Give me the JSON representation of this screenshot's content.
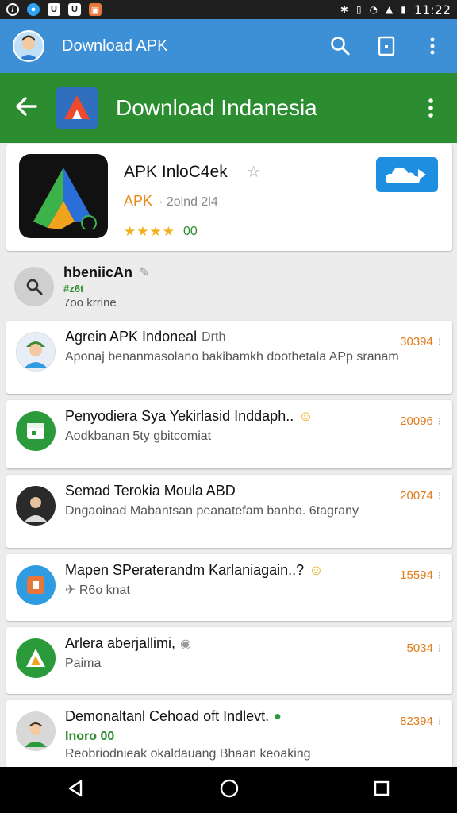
{
  "status_bar": {
    "time": "11:22"
  },
  "top_bar": {
    "title": "Download APK"
  },
  "header": {
    "title": "Download Indanesia"
  },
  "app": {
    "name": "APK InloC4ek",
    "brand": "APK",
    "date": "2oind 2l4",
    "rating_count": "00"
  },
  "search": {
    "title": "hbeniicAn",
    "tag": "#z6t",
    "subtitle": "7oo krrine"
  },
  "items": [
    {
      "title": "Agrein APK Indoneal",
      "title_extra": "Drth",
      "sub": "Aponaj benanmasolano bakibamkh doothetala APp sranam",
      "count": "30394",
      "avatar_color": "#e7eef7",
      "icon": "person"
    },
    {
      "title": "Penyodiera Sya Yekirlasid Inddaph..",
      "title_extra": "",
      "sub": "Aodkbanan 5ty gbitcomiat",
      "count": "20096",
      "avatar_color": "#2b9a3a",
      "icon": "calendar"
    },
    {
      "title": "Semad Terokia Moula ABD",
      "title_extra": "",
      "sub": "Dngaoinad Mabantsan peanatefam banbo. 6tagrany",
      "count": "20074",
      "avatar_color": "#2a2a2a",
      "icon": "person-dark"
    },
    {
      "title": "Mapen SPeraterandm Karlaniagain..?",
      "title_extra": "",
      "sub": "R6o knat",
      "count": "15594",
      "avatar_color": "#2f9be0",
      "icon": "app"
    },
    {
      "title": "Arlera aberjallimi,",
      "title_extra": "",
      "sub": "Paima",
      "count": "5034",
      "avatar_color": "#2b9a3a",
      "icon": "logo"
    },
    {
      "title": "Demonaltanl Cehoad oft Indlevt.",
      "title_extra": "",
      "sub_green": "Inoro 00",
      "sub": "Reobriodnieak okaldauang Bhaan keoaking",
      "count": "82394",
      "avatar_color": "#d8d8d8",
      "icon": "person-green"
    }
  ],
  "colors": {
    "blue_bar": "#3d8fd6",
    "green_bar": "#2b8d2f",
    "orange": "#e07b1a"
  }
}
